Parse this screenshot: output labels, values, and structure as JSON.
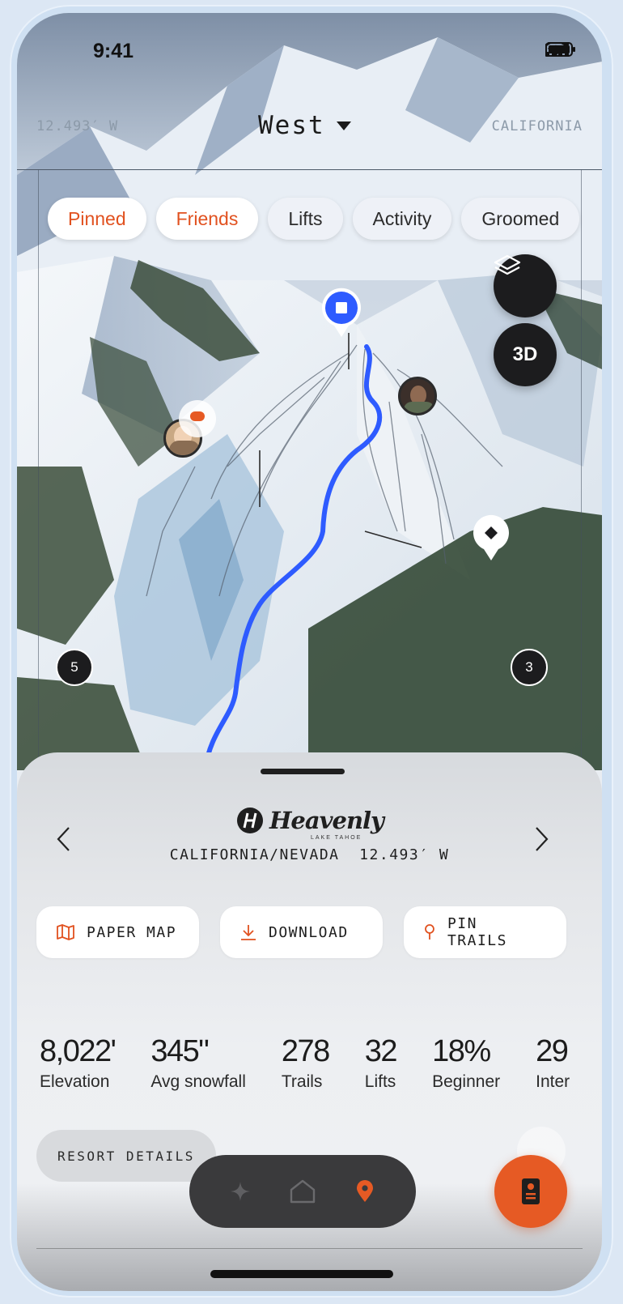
{
  "status_bar": {
    "time": "9:41"
  },
  "map_header": {
    "coord_left": "12.493′ W",
    "region": "West",
    "coord_right": "CALIFORNIA"
  },
  "filters": [
    {
      "label": "Pinned",
      "active": true
    },
    {
      "label": "Friends",
      "active": true
    },
    {
      "label": "Lifts",
      "active": false
    },
    {
      "label": "Activity",
      "active": false
    },
    {
      "label": "Groomed",
      "active": false
    }
  ],
  "map_controls": {
    "layers_icon": "layers-icon",
    "three_d_label": "3D"
  },
  "map_markers": {
    "left_count": "5",
    "right_count": "3"
  },
  "resort": {
    "logo_text": "Heavenly",
    "logo_subtext": "LAKE TAHOE",
    "location_line": "CALIFORNIA/NEVADA  12.493′ W"
  },
  "actions": {
    "paper_map": "PAPER MAP",
    "download": "DOWNLOAD",
    "pin_trails": "PIN TRAILS"
  },
  "stats": [
    {
      "value": "8,022'",
      "label": "Elevation"
    },
    {
      "value": "345\"",
      "label": "Avg snowfall"
    },
    {
      "value": "278",
      "label": "Trails"
    },
    {
      "value": "32",
      "label": "Lifts"
    },
    {
      "value": "18%",
      "label": "Beginner"
    },
    {
      "value": "29",
      "label": "Inter"
    }
  ],
  "details_button": "RESORT DETAILS",
  "tab_bar": {
    "active": "map-pin",
    "accent": "#e65a24"
  },
  "colors": {
    "accent": "#e1511f",
    "route": "#2e5bff"
  }
}
